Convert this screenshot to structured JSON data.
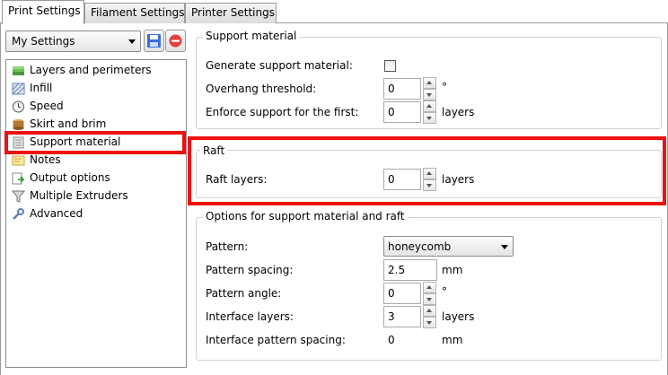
{
  "tabs": [
    "Print Settings",
    "Filament Settings",
    "Printer Settings"
  ],
  "preset": {
    "value": "My Settings"
  },
  "tree": [
    {
      "label": "Layers and perimeters",
      "icon": "layers-icon"
    },
    {
      "label": "Infill",
      "icon": "infill-icon"
    },
    {
      "label": "Speed",
      "icon": "speed-icon"
    },
    {
      "label": "Skirt and brim",
      "icon": "skirt-icon"
    },
    {
      "label": "Support material",
      "icon": "support-icon"
    },
    {
      "label": "Notes",
      "icon": "notes-icon"
    },
    {
      "label": "Output options",
      "icon": "output-icon"
    },
    {
      "label": "Multiple Extruders",
      "icon": "funnel-icon"
    },
    {
      "label": "Advanced",
      "icon": "wrench-icon"
    }
  ],
  "support": {
    "title": "Support material",
    "generate_label": "Generate support material:",
    "overhang_label": "Overhang threshold:",
    "overhang_value": "0",
    "overhang_unit": "°",
    "enforce_label": "Enforce support for the first:",
    "enforce_value": "0",
    "enforce_unit": "layers"
  },
  "raft": {
    "title": "Raft",
    "layers_label": "Raft layers:",
    "layers_value": "0",
    "layers_unit": "layers"
  },
  "options": {
    "title": "Options for support material and raft",
    "pattern_label": "Pattern:",
    "pattern_value": "honeycomb",
    "spacing_label": "Pattern spacing:",
    "spacing_value": "2.5",
    "spacing_unit": "mm",
    "angle_label": "Pattern angle:",
    "angle_value": "0",
    "angle_unit": "°",
    "interface_label": "Interface layers:",
    "interface_value": "3",
    "interface_unit": "layers",
    "ispacing_label": "Interface pattern spacing:",
    "ispacing_value": "0",
    "ispacing_unit": "mm"
  },
  "colors": {
    "highlight": "#ee1111",
    "delete": "#e04040",
    "save": "#3a6fd8"
  }
}
